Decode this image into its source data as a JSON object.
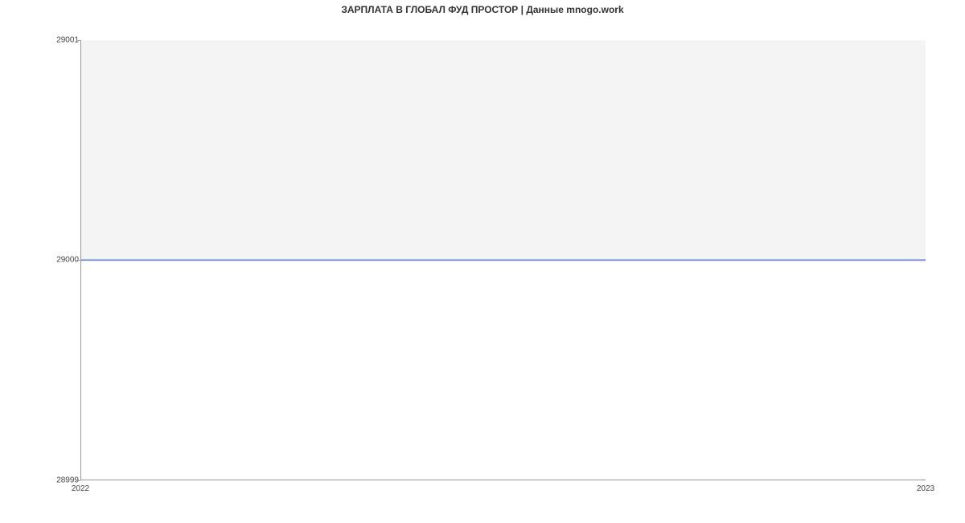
{
  "chart_data": {
    "type": "area",
    "title": "ЗАРПЛАТА В ГЛОБАЛ ФУД ПРОСТОР | Данные mnogo.work",
    "x": [
      "2022",
      "2023"
    ],
    "values": [
      29000,
      29000
    ],
    "xlabel": "",
    "ylabel": "",
    "ylim": [
      28999,
      29001
    ],
    "y_ticks": [
      "29001",
      "29000",
      "28999"
    ],
    "x_ticks": [
      "2022",
      "2023"
    ]
  }
}
